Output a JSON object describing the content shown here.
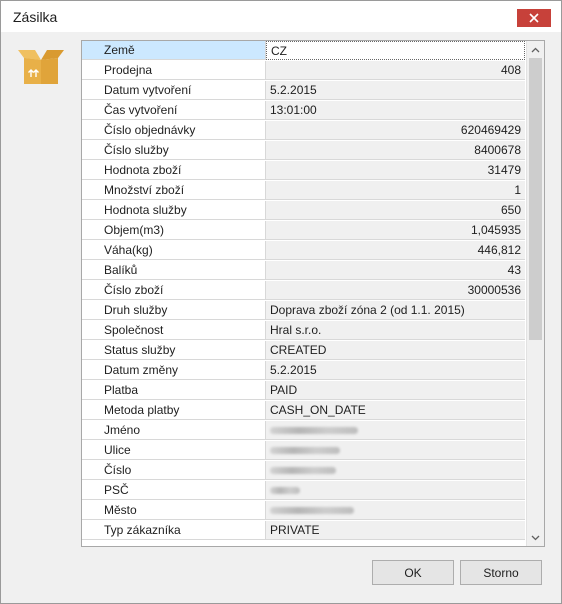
{
  "window": {
    "title": "Zásilka"
  },
  "icons": {
    "app": "open-box-icon",
    "close": "close-icon"
  },
  "properties": [
    {
      "label": "Země",
      "value": "CZ"
    },
    {
      "label": "Prodejna",
      "value": "408"
    },
    {
      "label": "Datum vytvoření",
      "value": "5.2.2015"
    },
    {
      "label": "Čas vytvoření",
      "value": "13:01:00"
    },
    {
      "label": "Číslo objednávky",
      "value": "620469429"
    },
    {
      "label": "Číslo služby",
      "value": "8400678"
    },
    {
      "label": "Hodnota zboží",
      "value": "31479"
    },
    {
      "label": "Množství zboží",
      "value": "1"
    },
    {
      "label": "Hodnota služby",
      "value": "650"
    },
    {
      "label": "Objem(m3)",
      "value": "1,045935"
    },
    {
      "label": "Váha(kg)",
      "value": "446,812"
    },
    {
      "label": "Balíků",
      "value": "43"
    },
    {
      "label": "Číslo zboží",
      "value": "30000536"
    },
    {
      "label": "Druh služby",
      "value": "Doprava zboží zóna 2 (od 1.1. 2015)"
    },
    {
      "label": "Společnost",
      "value": "Hral s.r.o."
    },
    {
      "label": "Status služby",
      "value": "CREATED"
    },
    {
      "label": "Datum změny",
      "value": "5.2.2015"
    },
    {
      "label": "Platba",
      "value": "PAID"
    },
    {
      "label": "Metoda platby",
      "value": "CASH_ON_DATE"
    },
    {
      "label": "Jméno",
      "value": ""
    },
    {
      "label": "Ulice",
      "value": ""
    },
    {
      "label": "Číslo",
      "value": ""
    },
    {
      "label": "PSČ",
      "value": ""
    },
    {
      "label": "Město",
      "value": ""
    },
    {
      "label": "Typ zákazníka",
      "value": "PRIVATE"
    }
  ],
  "buttons": {
    "ok": "OK",
    "storno": "Storno"
  },
  "colors": {
    "selected_row": "#cce8ff",
    "close_button": "#c7413a"
  }
}
